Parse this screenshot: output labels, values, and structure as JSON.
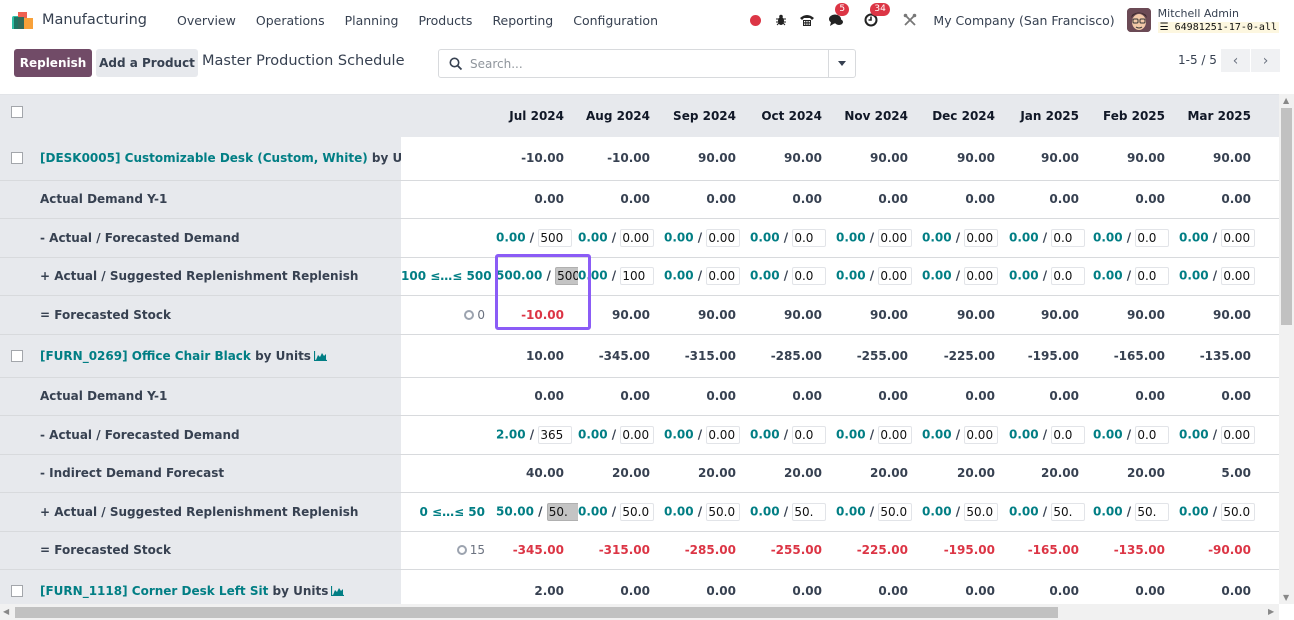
{
  "navbar": {
    "app_name": "Manufacturing",
    "menu": [
      "Overview",
      "Operations",
      "Planning",
      "Products",
      "Reporting",
      "Configuration"
    ],
    "chat_badge": "5",
    "activity_badge": "34",
    "company": "My Company (San Francisco)",
    "user_name": "Mitchell Admin",
    "database": "64981251-17-0-all"
  },
  "control_panel": {
    "replenish_label": "Replenish",
    "add_product_label": "Add a Product",
    "title": "Master Production Schedule",
    "search_placeholder": "Search...",
    "pager": "1-5 / 5"
  },
  "grid": {
    "months": [
      "Jul 2024",
      "Aug 2024",
      "Sep 2024",
      "Oct 2024",
      "Nov 2024",
      "Dec 2024",
      "Jan 2025",
      "Feb 2025",
      "Mar 2025"
    ],
    "products": [
      {
        "name": "[DESK0005] Customizable Desk (Custom, White)",
        "uom": "by Units",
        "starting": [
          "-10.00",
          "-10.00",
          "90.00",
          "90.00",
          "90.00",
          "90.00",
          "90.00",
          "90.00",
          "90.00"
        ],
        "demand_y1_label": "Actual Demand Y-1",
        "demand_y1": [
          "0.00",
          "0.00",
          "0.00",
          "0.00",
          "0.00",
          "0.00",
          "0.00",
          "0.00",
          "0.00"
        ],
        "forecast_label": "- Actual / Forecasted Demand",
        "forecast_actual": [
          "0.00",
          "0.00",
          "0.00",
          "0.00",
          "0.00",
          "0.00",
          "0.00",
          "0.00",
          "0.00"
        ],
        "forecast_input": [
          "500",
          "0.00",
          "0.00",
          "0.0",
          "0.00",
          "0.00",
          "0.0",
          "0.0",
          "0.00"
        ],
        "replenish_label": "+ Actual / Suggested Replenishment",
        "replenish_link": "Replenish",
        "replenish_range": "100 ≤…≤ 500",
        "replenish_actual": [
          "500.00",
          "0.00",
          "0.00",
          "0.00",
          "0.00",
          "0.00",
          "0.00",
          "0.00",
          "0.00"
        ],
        "replenish_input": [
          "500",
          "100",
          "0.00",
          "0.0",
          "0.00",
          "0.00",
          "0.0",
          "0.0",
          "0.00"
        ],
        "stock_label": "= Forecasted Stock",
        "safety_stock": "0",
        "stock": [
          "-10.00",
          "90.00",
          "90.00",
          "90.00",
          "90.00",
          "90.00",
          "90.00",
          "90.00",
          "90.00"
        ],
        "stock_negative": [
          true,
          false,
          false,
          false,
          false,
          false,
          false,
          false,
          false
        ]
      },
      {
        "name": "[FURN_0269] Office Chair Black",
        "uom": "by Units",
        "starting": [
          "10.00",
          "-345.00",
          "-315.00",
          "-285.00",
          "-255.00",
          "-225.00",
          "-195.00",
          "-165.00",
          "-135.00"
        ],
        "demand_y1_label": "Actual Demand Y-1",
        "demand_y1": [
          "0.00",
          "0.00",
          "0.00",
          "0.00",
          "0.00",
          "0.00",
          "0.00",
          "0.00",
          "0.00"
        ],
        "forecast_label": "- Actual / Forecasted Demand",
        "forecast_actual": [
          "2.00",
          "0.00",
          "0.00",
          "0.00",
          "0.00",
          "0.00",
          "0.00",
          "0.00",
          "0.00"
        ],
        "forecast_input": [
          "365",
          "0.00",
          "0.00",
          "0.0",
          "0.00",
          "0.00",
          "0.0",
          "0.0",
          "0.00"
        ],
        "indirect_label": "- Indirect Demand Forecast",
        "indirect": [
          "40.00",
          "20.00",
          "20.00",
          "20.00",
          "20.00",
          "20.00",
          "20.00",
          "20.00",
          "5.00"
        ],
        "replenish_label": "+ Actual / Suggested Replenishment",
        "replenish_link": "Replenish",
        "replenish_range": "0 ≤…≤ 50",
        "replenish_actual": [
          "50.00",
          "0.00",
          "0.00",
          "0.00",
          "0.00",
          "0.00",
          "0.00",
          "0.00",
          "0.00"
        ],
        "replenish_input": [
          "50.",
          "50.0",
          "50.0",
          "50.",
          "50.0",
          "50.0",
          "50.",
          "50.",
          "50.0"
        ],
        "stock_label": "= Forecasted Stock",
        "safety_stock": "15",
        "stock": [
          "-345.00",
          "-315.00",
          "-285.00",
          "-255.00",
          "-225.00",
          "-195.00",
          "-165.00",
          "-135.00",
          "-90.00"
        ],
        "stock_negative": [
          true,
          true,
          true,
          true,
          true,
          true,
          true,
          true,
          true
        ]
      },
      {
        "name": "[FURN_1118] Corner Desk Left Sit",
        "uom": "by Units",
        "starting": [
          "2.00",
          "0.00",
          "0.00",
          "0.00",
          "0.00",
          "0.00",
          "0.00",
          "0.00",
          "0.00"
        ]
      }
    ]
  },
  "colors": {
    "brand": "#714b67",
    "teal": "#017e84",
    "negative": "#dc3545",
    "highlight": "#8b5cf6"
  }
}
